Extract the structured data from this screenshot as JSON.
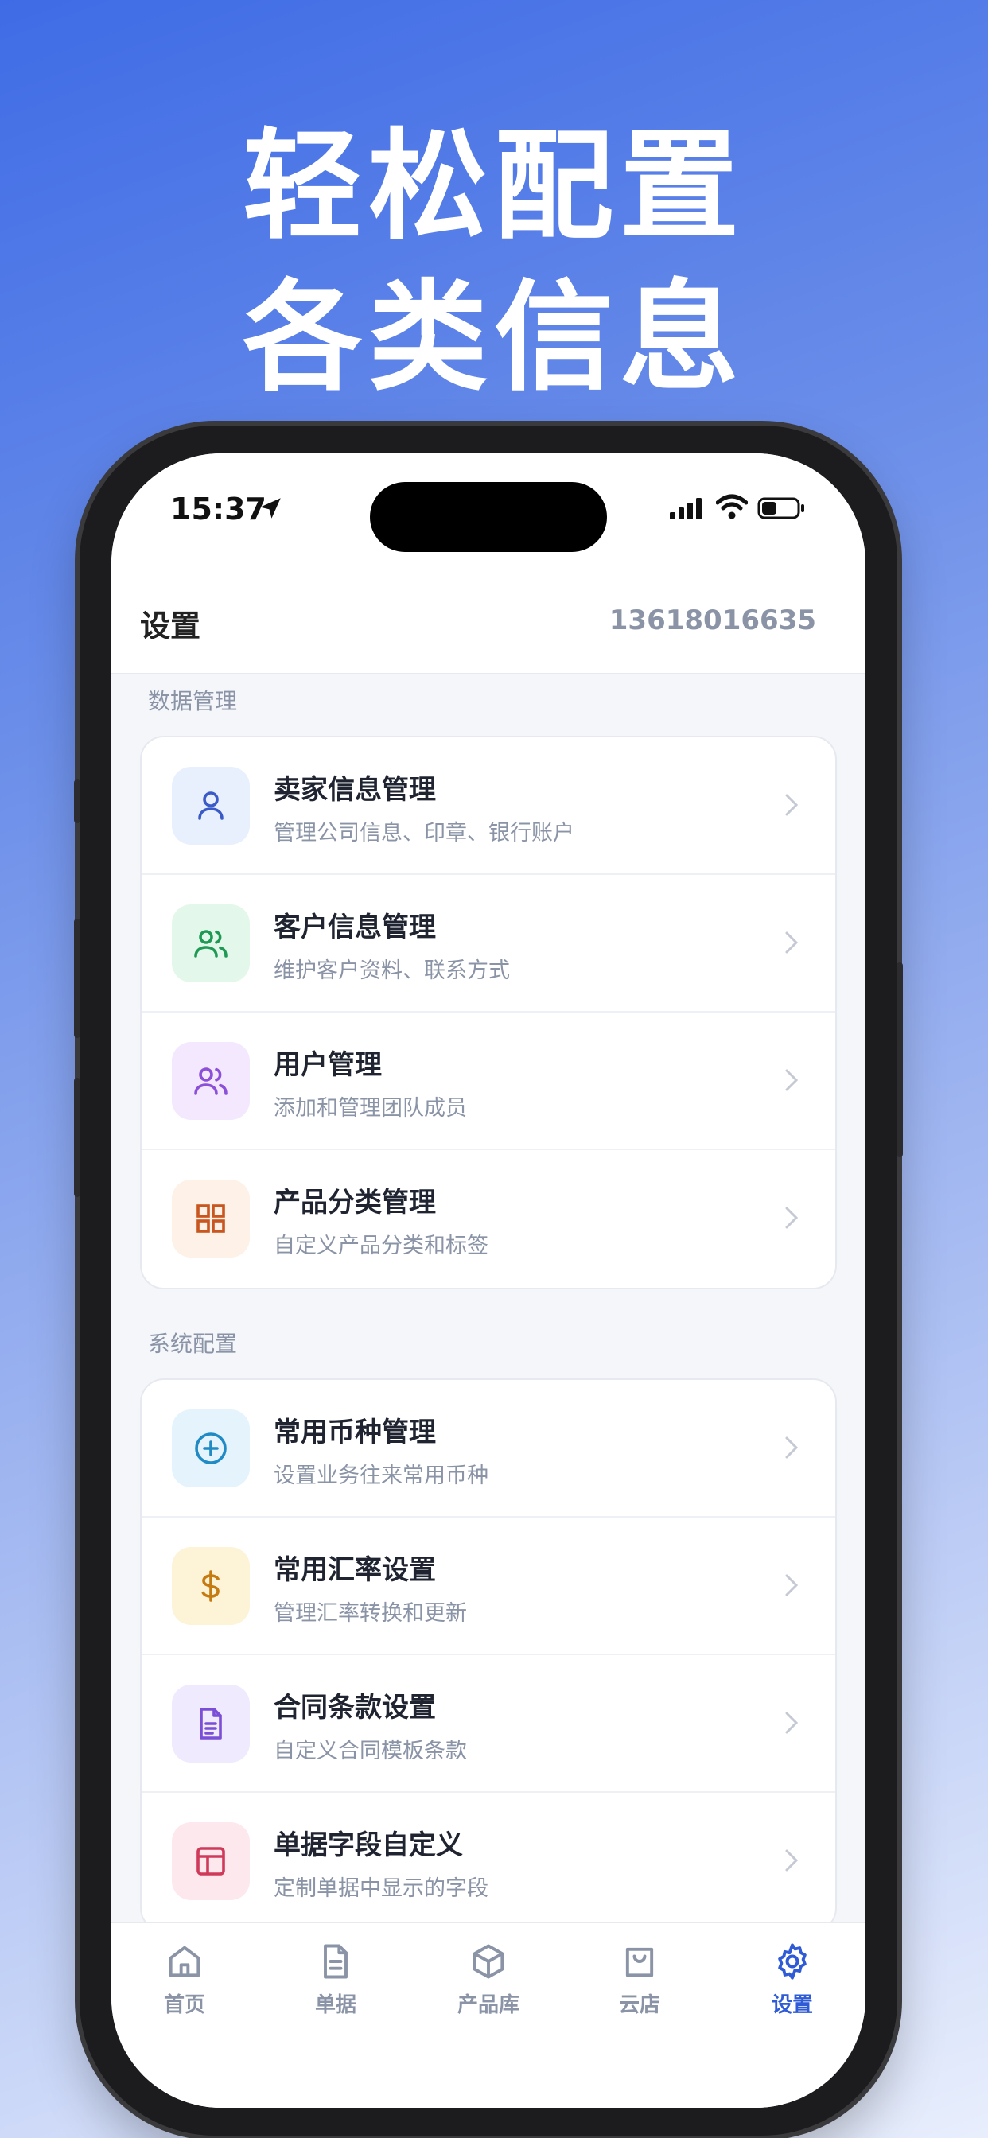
{
  "headline": {
    "line1": "轻松配置",
    "line2": "各类信息"
  },
  "status_bar": {
    "time": "15:37"
  },
  "header": {
    "title": "设置",
    "account": "13618016635"
  },
  "sections": [
    {
      "label": "数据管理",
      "items": [
        {
          "title": "卖家信息管理",
          "subtitle": "管理公司信息、印章、银行账户",
          "icon": "user-icon",
          "icon_bg": "#e9f0fd",
          "icon_color": "#3a5bc7"
        },
        {
          "title": "客户信息管理",
          "subtitle": "维护客户资料、联系方式",
          "icon": "users-icon",
          "icon_bg": "#e3f8ea",
          "icon_color": "#1f9a55"
        },
        {
          "title": "用户管理",
          "subtitle": "添加和管理团队成员",
          "icon": "team-icon",
          "icon_bg": "#f3e8fd",
          "icon_color": "#8b4fd8"
        },
        {
          "title": "产品分类管理",
          "subtitle": "自定义产品分类和标签",
          "icon": "grid-icon",
          "icon_bg": "#fdf1e8",
          "icon_color": "#c9561f"
        }
      ]
    },
    {
      "label": "系统配置",
      "items": [
        {
          "title": "常用币种管理",
          "subtitle": "设置业务往来常用币种",
          "icon": "plus-circle-icon",
          "icon_bg": "#e4f3fc",
          "icon_color": "#1f8ac4"
        },
        {
          "title": "常用汇率设置",
          "subtitle": "管理汇率转换和更新",
          "icon": "dollar-icon",
          "icon_bg": "#fdf3d6",
          "icon_color": "#c57a12"
        },
        {
          "title": "合同条款设置",
          "subtitle": "自定义合同模板条款",
          "icon": "document-icon",
          "icon_bg": "#efeafd",
          "icon_color": "#7a4ed6"
        },
        {
          "title": "单据字段自定义",
          "subtitle": "定制单据中显示的字段",
          "icon": "layout-icon",
          "icon_bg": "#fde8ee",
          "icon_color": "#d03a5a"
        }
      ]
    }
  ],
  "tabbar": [
    {
      "label": "首页",
      "icon": "home-icon",
      "active": false
    },
    {
      "label": "单据",
      "icon": "file-icon",
      "active": false
    },
    {
      "label": "产品库",
      "icon": "box-icon",
      "active": false
    },
    {
      "label": "云店",
      "icon": "bag-icon",
      "active": false
    },
    {
      "label": "设置",
      "icon": "gear-icon",
      "active": true
    }
  ],
  "colors": {
    "accent": "#2f5bd6",
    "muted": "#8a94a6",
    "text": "#1f2430"
  }
}
